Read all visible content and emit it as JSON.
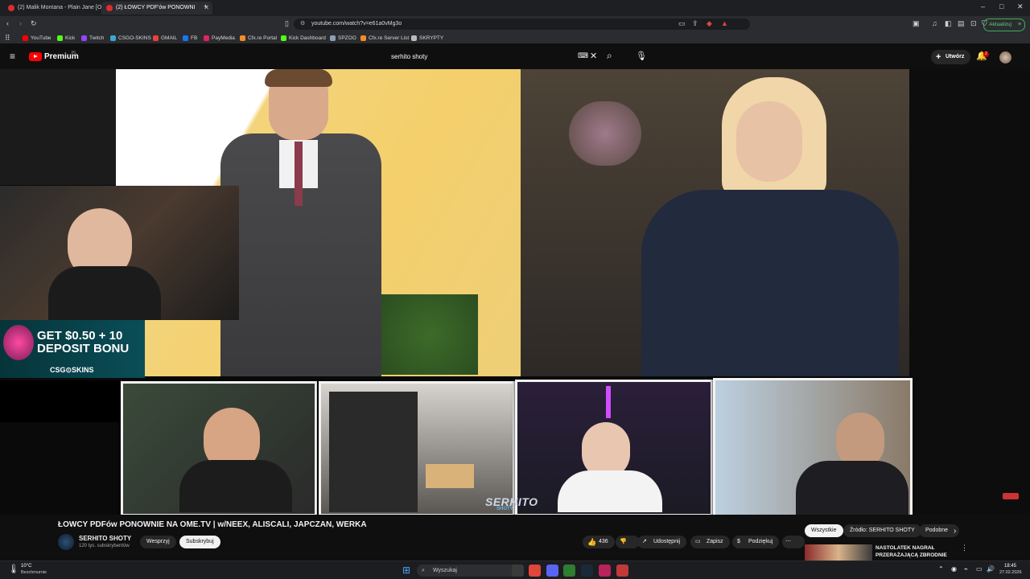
{
  "browser": {
    "tabs": [
      {
        "title": "(2) Malik Montana - Plain Jane [Offic"
      },
      {
        "title": "(2) ŁOWCY PDF'ów PONOWNI"
      }
    ],
    "url": "youtube.com/watch?v=e61a0vMg3o",
    "update_label": "Aktualizuj"
  },
  "bookmarks": [
    {
      "label": "YouTube",
      "color": "#ff0000"
    },
    {
      "label": "Kick",
      "color": "#53fc18"
    },
    {
      "label": "Twitch",
      "color": "#9146ff"
    },
    {
      "label": "CSGO-SKINS",
      "color": "#3aa7d8"
    },
    {
      "label": "GMAIL",
      "color": "#ea4335"
    },
    {
      "label": "FB",
      "color": "#1877f2"
    },
    {
      "label": "PayMedia",
      "color": "#e0245e"
    },
    {
      "label": "Cfx.re Portal",
      "color": "#f28c28"
    },
    {
      "label": "Kick Dashboard",
      "color": "#53fc18"
    },
    {
      "label": "SPZOO",
      "color": "#8aa0b8"
    },
    {
      "label": "Cfx.re Server List",
      "color": "#f28c28"
    },
    {
      "label": "SKRYPTY",
      "color": "#bbbbbb"
    }
  ],
  "youtube": {
    "logo_text": "Premium",
    "region": "PL",
    "search_query": "serhito shoty",
    "create_label": "Utwórz",
    "notification_count": "2"
  },
  "video": {
    "ad_line1": "GET $0.50 + 10",
    "ad_line2": "DEPOSIT BONU",
    "ad_brand": "CSG⊙SKINS",
    "watermark": "SERHITO",
    "watermark_sub": "SHOTY"
  },
  "meta": {
    "title": "ŁOWCY PDFów PONOWNIE NA OME.TV | w/NEEX, ALISCALI, JAPCZAN, WERKA",
    "channel": "SERHITO SHOTY",
    "subscribers": "120 tys. subskrybentów",
    "support_label": "Wesprzyj",
    "subscribe_label": "Subskrybuj",
    "likes": "436",
    "share_label": "Udostępnij",
    "save_label": "Zapisz",
    "thanks_label": "Podziękuj"
  },
  "chips": [
    "Wszystkie",
    "Źródło: SERHITO SHOTY",
    "Podobne"
  ],
  "recommendation": {
    "title": "NASTOLATEK NAGRAŁ PRZERAŻAJĄCĄ ZBRODNIE"
  },
  "taskbar": {
    "temperature": "10°C",
    "weather": "Bezchmurnie",
    "search_placeholder": "Wyszukaj",
    "time": "18:45",
    "date": "27.02.2026"
  }
}
